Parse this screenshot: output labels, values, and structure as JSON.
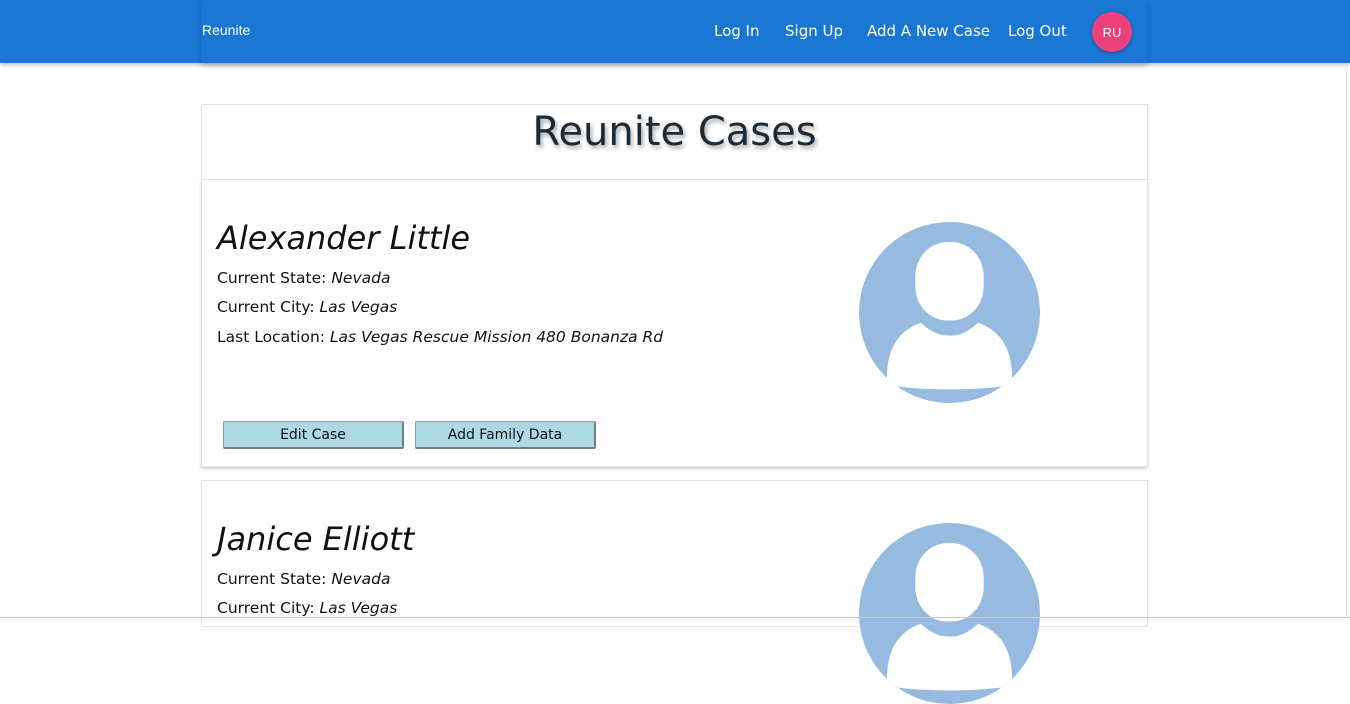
{
  "navbar": {
    "brand": "Reunite",
    "links": [
      "Log In",
      "Sign Up",
      "Add A New Case",
      "Log Out"
    ],
    "avatar_initials": "RU",
    "bar_color": "#1976d2",
    "avatar_color": "#ec407a"
  },
  "page": {
    "title": "Reunite Cases"
  },
  "field_labels": {
    "state": "Current State: ",
    "city": "Current City: ",
    "location": "Last Location: "
  },
  "cases": [
    {
      "name": "Alexander Little",
      "state": "Nevada",
      "city": "Las Vegas",
      "location": "Las Vegas Rescue Mission 480 Bonanza Rd",
      "edit_label": "Edit Case",
      "family_label": "Add Family Data",
      "photo_icon": "person-placeholder-icon"
    },
    {
      "name": "Janice Elliott",
      "state": "Nevada",
      "city": "Las Vegas",
      "photo_icon": "person-placeholder-icon"
    }
  ],
  "colors": {
    "button_bg": "#add8e6",
    "placeholder": "#97bbe0"
  }
}
